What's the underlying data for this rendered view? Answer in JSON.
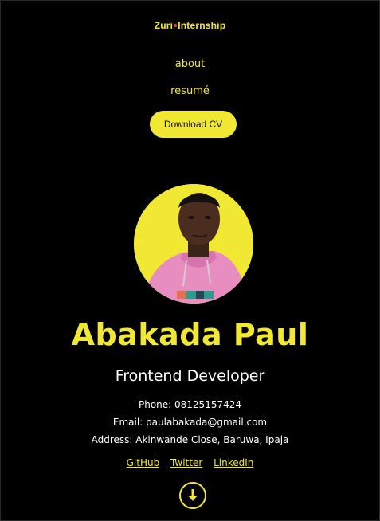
{
  "header": {
    "logo_left": "Zuri",
    "logo_right": "Internship"
  },
  "nav": {
    "about": "about",
    "resume": "resumé"
  },
  "cta": {
    "download_label": "Download CV"
  },
  "profile": {
    "name": "Abakada Paul",
    "role": "Frontend Developer",
    "phone": "Phone: 08125157424",
    "email": "Email: paulabakada@gmail.com",
    "address": "Address: Akinwande Close, Baruwa, Ipaja"
  },
  "social": {
    "github": "GitHub",
    "twitter": "Twitter",
    "linkedin": "LinkedIn"
  },
  "colors": {
    "accent": "#f1e834",
    "background": "#000000",
    "text": "#ffffff"
  },
  "icons": {
    "scroll": "arrow-down-icon"
  }
}
